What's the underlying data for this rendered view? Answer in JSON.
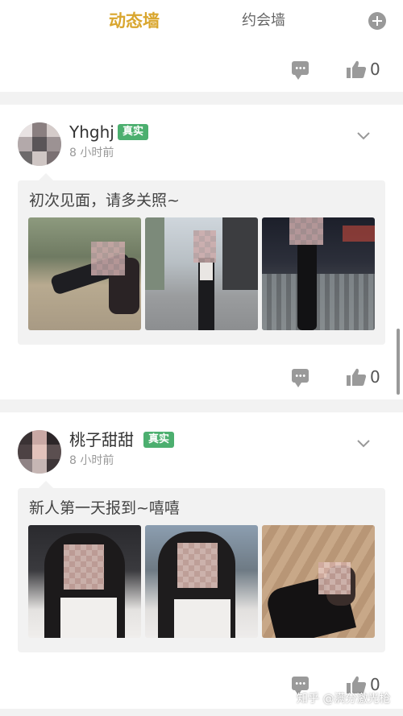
{
  "header": {
    "tabs": [
      {
        "label": "动态墙",
        "active": true
      },
      {
        "label": "约会墙",
        "active": false
      }
    ],
    "add_icon": "plus-circle-icon"
  },
  "top_post": {
    "likes": "0"
  },
  "posts": [
    {
      "username": "Yhghj",
      "badge": "真实",
      "time": "8 小时前",
      "text": "初次见面，请多关照~",
      "photo_count": 3,
      "likes": "0"
    },
    {
      "username": "桃子甜甜",
      "badge": "真实",
      "time": "8 小时前",
      "text": "新人第一天报到~嘻嘻",
      "photo_count": 3,
      "likes": "0"
    }
  ],
  "watermark": "知乎 @满分激光枪",
  "colors": {
    "accent": "#d9a62e",
    "badge": "#4caf6f",
    "background": "#f2f2f2"
  }
}
